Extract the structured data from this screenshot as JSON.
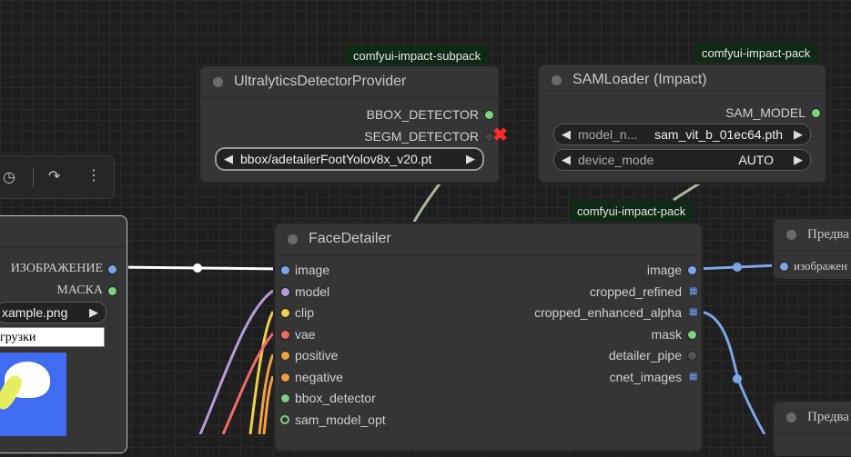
{
  "badges": {
    "subpack": "comfyui-impact-subpack",
    "pack_top": "comfyui-impact-pack",
    "pack_mid": "comfyui-impact-pack"
  },
  "ultralytics": {
    "title": "UltralyticsDetectorProvider",
    "outputs": [
      "BBOX_DETECTOR",
      "SEGM_DETECTOR"
    ],
    "model_value": "bbox/adetailerFootYolov8x_v20.pt"
  },
  "samloader": {
    "title": "SAMLoader (Impact)",
    "output": "SAM_MODEL",
    "widgets": [
      {
        "name": "model_n...",
        "value": "sam_vit_b_01ec64.pth"
      },
      {
        "name": "device_mode",
        "value": "AUTO"
      }
    ]
  },
  "facedetailer": {
    "title": "FaceDetailer",
    "inputs": [
      "image",
      "model",
      "clip",
      "vae",
      "positive",
      "negative",
      "bbox_detector",
      "sam_model_opt"
    ],
    "outputs": [
      "image",
      "cropped_refined",
      "cropped_enhanced_alpha",
      "mask",
      "detailer_pipe",
      "cnet_images"
    ]
  },
  "load_image": {
    "outputs": [
      "ИЗОБРАЖЕНИЕ",
      "МАСКА"
    ],
    "file_value": "xample.png",
    "upload_label": "грузки"
  },
  "preview_top": {
    "title": "Предва",
    "input": "изображен"
  },
  "preview_bottom": {
    "title": "Предва"
  },
  "colors": {
    "image": "#7aa6e8",
    "model": "#b39ddb",
    "clip": "#f0d04a",
    "vae": "#ef6b6b",
    "conditioning": "#f0a040",
    "green": "#7ed27e",
    "wire_white": "#ffffff",
    "wire_gray": "#a8b8a0"
  }
}
